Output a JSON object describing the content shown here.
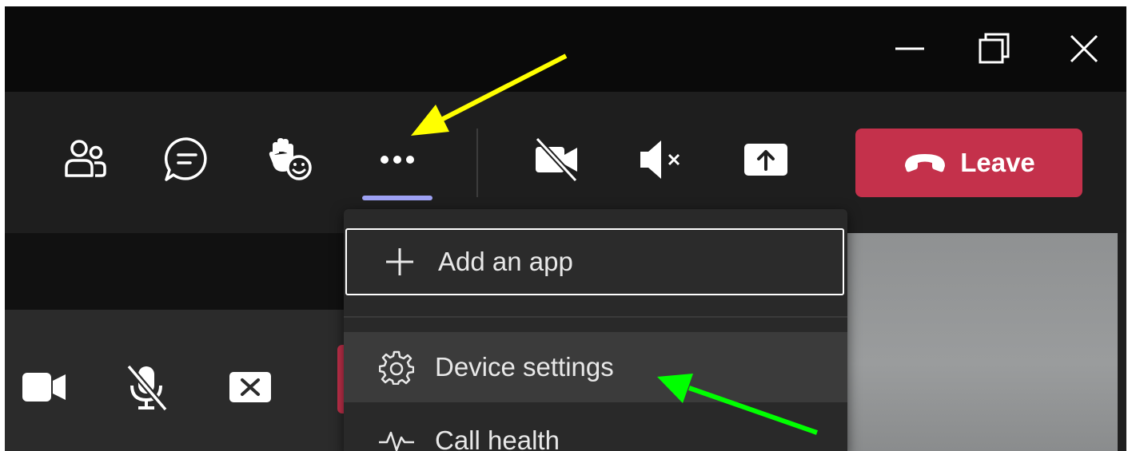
{
  "window": {
    "controls": {
      "minimize": "minimize-icon",
      "maximize": "restore-icon",
      "close": "close-icon"
    }
  },
  "toolbar": {
    "icons": [
      "people-icon",
      "chat-icon",
      "raise-hand-icon",
      "more-options-icon",
      "camera-off-icon",
      "speaker-mute-icon",
      "share-screen-icon"
    ],
    "leave_label": "Leave"
  },
  "menu": {
    "items": [
      {
        "label": "Add an app",
        "icon": "plus-icon"
      },
      {
        "label": "Device settings",
        "icon": "gear-icon"
      },
      {
        "label": "Call health",
        "icon": "pulse-icon"
      }
    ]
  },
  "colors": {
    "leave": "#c4314b",
    "active_underline": "#9ea2f4",
    "annotation_yellow": "#ffff00",
    "annotation_green": "#00ff00"
  }
}
